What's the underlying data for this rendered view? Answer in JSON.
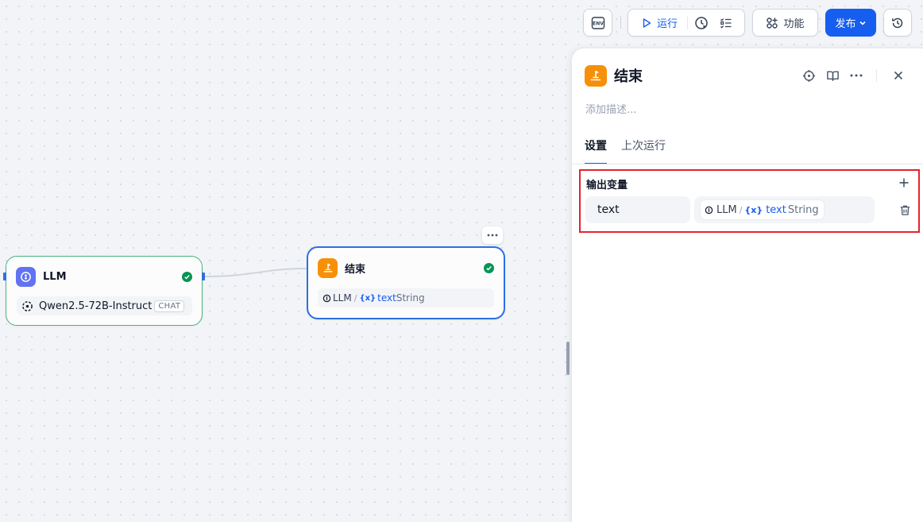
{
  "toolbar": {
    "env_label": "ENV",
    "run_label": "运行",
    "func_label": "功能",
    "publish_label": "发布"
  },
  "nodes": {
    "llm": {
      "title": "LLM",
      "model": "Qwen2.5-72B-Instruct",
      "mode_badge": "CHAT"
    },
    "end": {
      "title": "结束",
      "var_source": "LLM",
      "separator": "/",
      "var_brace": "{x}",
      "var_name": "text",
      "var_type": "String"
    }
  },
  "panel": {
    "title": "结束",
    "description_placeholder": "添加描述...",
    "tabs": [
      {
        "label": "设置",
        "active": true
      },
      {
        "label": "上次运行",
        "active": false
      }
    ],
    "output_vars": {
      "section_label": "输出变量",
      "rows": [
        {
          "name": "text",
          "source": "LLM",
          "separator": "/",
          "brace": "{x}",
          "var": "text",
          "type": "String"
        }
      ]
    }
  },
  "colors": {
    "accent": "#155eef",
    "success": "#079455",
    "end_node": "#f79009",
    "llm_node": "#6172f3",
    "highlight": "#e5222c"
  }
}
